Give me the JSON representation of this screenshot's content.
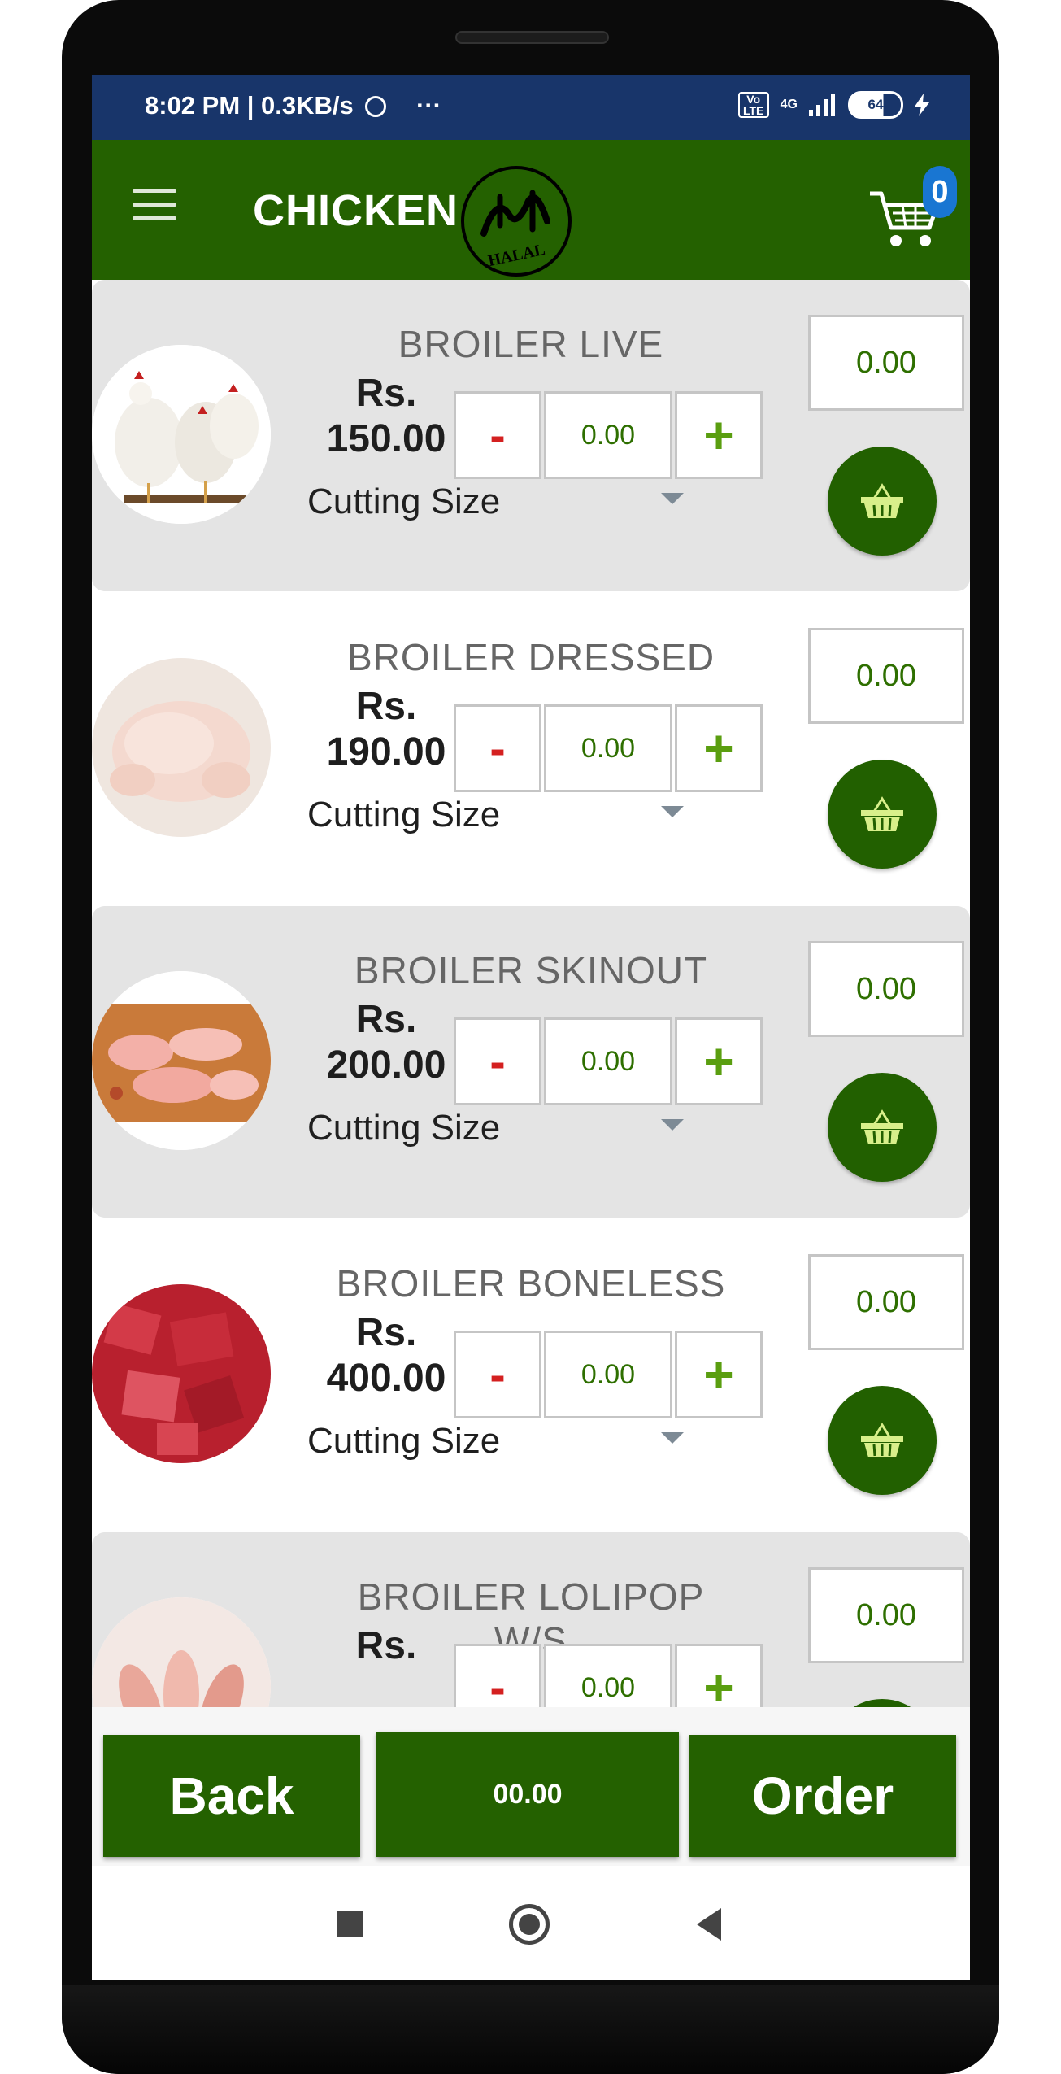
{
  "status_bar": {
    "time_speed": "8:02 PM | 0.3KB/s",
    "dots": "···",
    "volte": "Vo LTE",
    "network": "4G",
    "battery": "64"
  },
  "app_bar": {
    "title": "CHICKEN",
    "logo_text": "HALAL",
    "cart_count": "0",
    "accent_color": "#246100"
  },
  "products": [
    {
      "name": "BROILER LIVE",
      "price_prefix": "Rs.",
      "price": "150.00",
      "qty": "0.00",
      "cutting": "Cutting Size",
      "total": "0.00",
      "minus": "-",
      "plus": "+"
    },
    {
      "name": "BROILER DRESSED",
      "price_prefix": "Rs.",
      "price": "190.00",
      "qty": "0.00",
      "cutting": "Cutting Size",
      "total": "0.00",
      "minus": "-",
      "plus": "+"
    },
    {
      "name": "BROILER SKINOUT",
      "price_prefix": "Rs.",
      "price": "200.00",
      "qty": "0.00",
      "cutting": "Cutting Size",
      "total": "0.00",
      "minus": "-",
      "plus": "+"
    },
    {
      "name": "BROILER BONELESS",
      "price_prefix": "Rs.",
      "price": "400.00",
      "qty": "0.00",
      "cutting": "Cutting Size",
      "total": "0.00",
      "minus": "-",
      "plus": "+"
    },
    {
      "name": "BROILER LOLIPOP W/S",
      "price_prefix": "Rs.",
      "price": "",
      "qty": "0.00",
      "cutting": "",
      "total": "0.00",
      "minus": "-",
      "plus": "+"
    }
  ],
  "bottom_bar": {
    "back_label": "Back",
    "total": "00.00",
    "order_label": "Order"
  }
}
